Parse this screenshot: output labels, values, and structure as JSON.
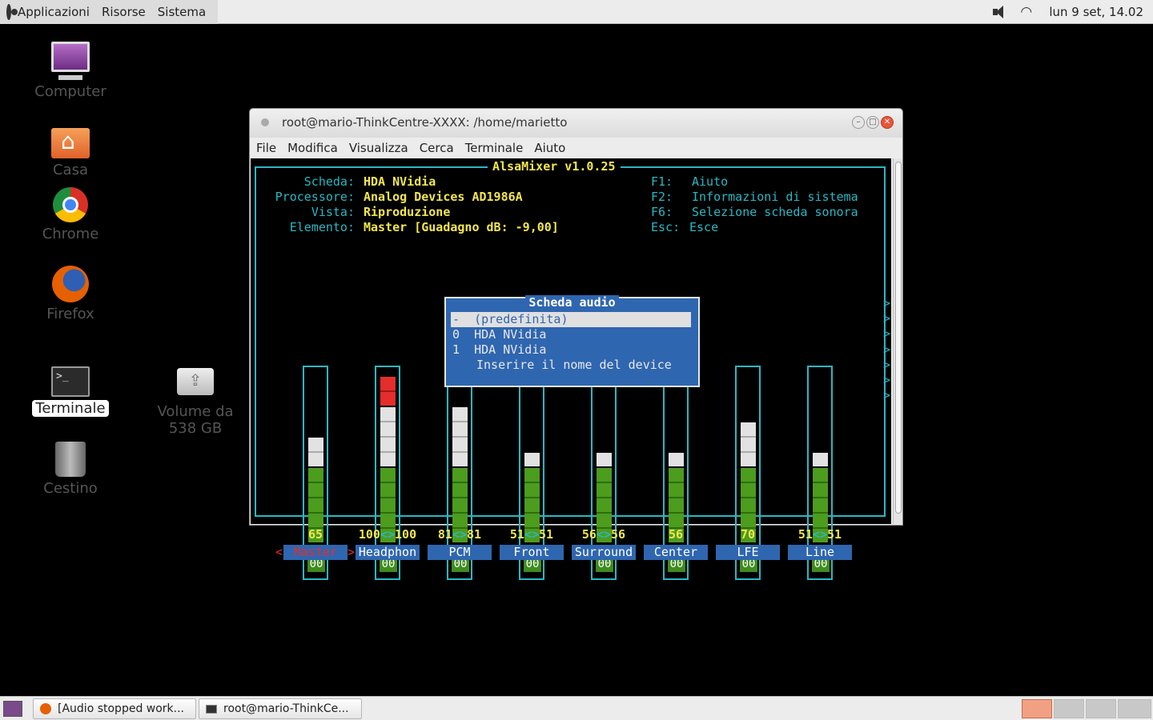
{
  "top_panel": {
    "menus": [
      "Applicazioni",
      "Risorse",
      "Sistema"
    ],
    "clock": "lun  9 set, 14.02"
  },
  "desktop": {
    "icons": [
      {
        "label": "Computer",
        "icon": "computer-icon"
      },
      {
        "label": "Casa",
        "icon": "home-folder-icon"
      },
      {
        "label": "Chrome",
        "icon": "chrome-icon"
      },
      {
        "label": "Firefox",
        "icon": "firefox-icon"
      },
      {
        "label": "Terminale",
        "icon": "terminal-icon"
      },
      {
        "label": "Cestino",
        "icon": "trash-icon"
      }
    ],
    "volume_label_1": "Volume da",
    "volume_label_2": "538 GB"
  },
  "window": {
    "title": "root@mario-ThinkCentre-XXXX: /home/marietto",
    "menus": [
      "File",
      "Modifica",
      "Visualizza",
      "Cerca",
      "Terminale",
      "Aiuto"
    ]
  },
  "alsamixer": {
    "title": "AlsaMixer v1.0.25",
    "info": [
      {
        "key": "Scheda:",
        "value": "HDA NVidia"
      },
      {
        "key": "Processore:",
        "value": "Analog Devices AD1986A"
      },
      {
        "key": "Vista:",
        "value": "Riproduzione"
      },
      {
        "key": "Elemento:",
        "value": "Master [Guadagno dB: -9,00]"
      }
    ],
    "keys": [
      {
        "key": "F1:",
        "desc": "Aiuto"
      },
      {
        "key": "F2:",
        "desc": "Informazioni di sistema"
      },
      {
        "key": "F6:",
        "desc": "Selezione scheda sonora"
      },
      {
        "key": "Esc:",
        "desc": "Esce"
      }
    ],
    "mute_label": "00",
    "channels": [
      {
        "name": "Master",
        "value_text": "65",
        "level": 65
      },
      {
        "name": "Headphon",
        "value_text": "100<>100",
        "level": 100
      },
      {
        "name": "PCM",
        "value_text": "81<>81",
        "level": 81
      },
      {
        "name": "Front",
        "value_text": "51<>51",
        "level": 51
      },
      {
        "name": "Surround",
        "value_text": "56<>56",
        "level": 56
      },
      {
        "name": "Center",
        "value_text": "56",
        "level": 56
      },
      {
        "name": "LFE",
        "value_text": "70",
        "level": 70
      },
      {
        "name": "Line",
        "value_text": "51<>51",
        "level": 51
      }
    ],
    "dialog": {
      "title": "Scheda audio",
      "items": [
        {
          "prefix": "-",
          "label": "(predefinita)"
        },
        {
          "prefix": "0",
          "label": "HDA NVidia"
        },
        {
          "prefix": "1",
          "label": "HDA NVidia"
        },
        {
          "prefix": "",
          "label": "Inserire il nome del device"
        }
      ]
    }
  },
  "taskbar": {
    "items": [
      "[Audio stopped work...",
      "root@mario-ThinkCe..."
    ]
  },
  "colors": {
    "cyan": "#2ab7c4",
    "yellow": "#f2e64e",
    "dialog_blue": "#2f66b0"
  }
}
